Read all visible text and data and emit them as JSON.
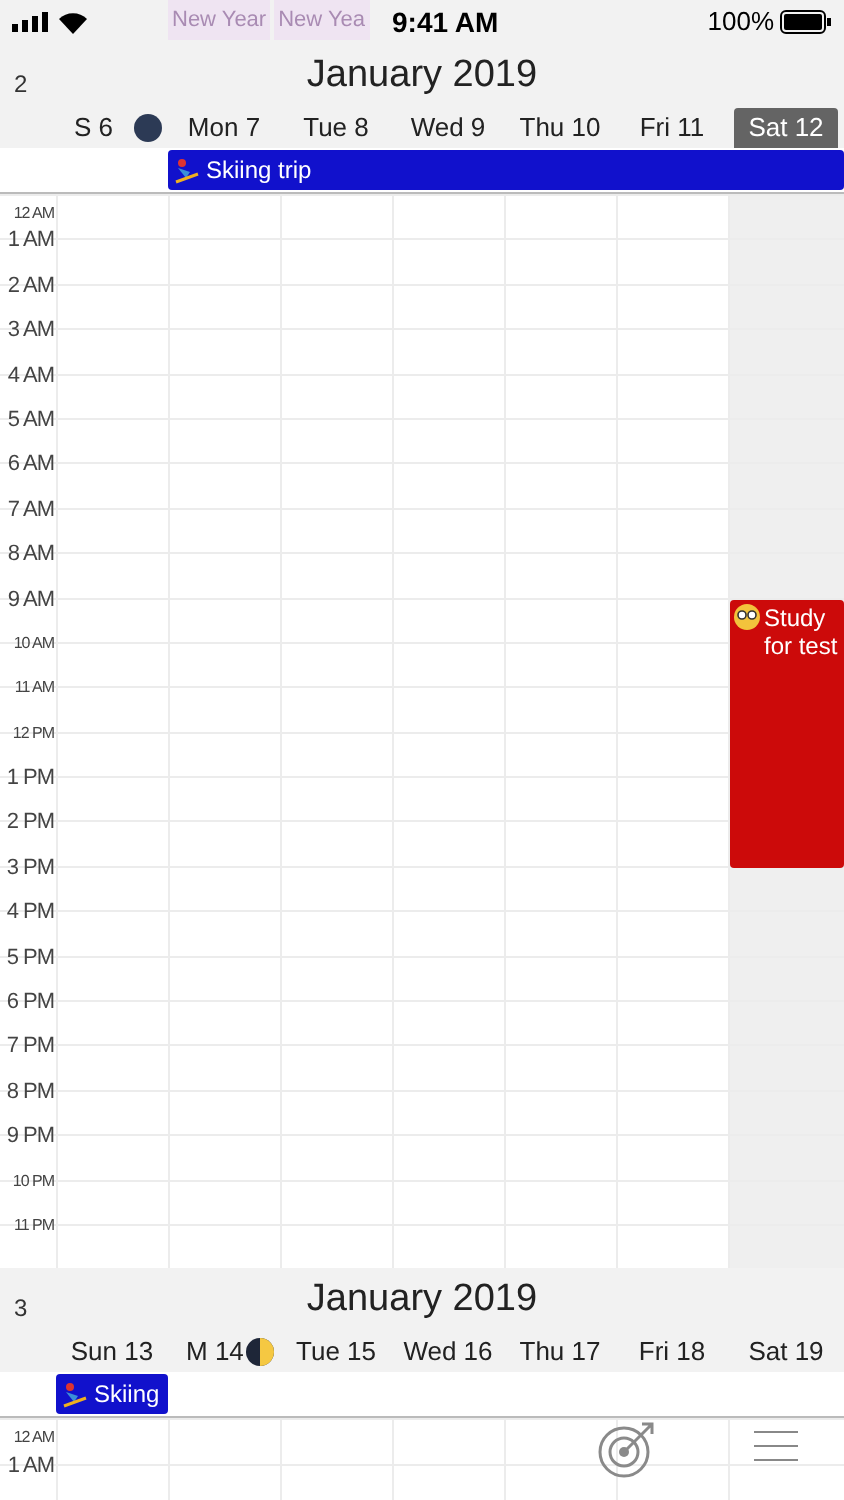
{
  "status_bar": {
    "time": "9:41 AM",
    "battery": "100%"
  },
  "background_events": [
    "New Year",
    "New Yea"
  ],
  "weeks": [
    {
      "week_number": "2",
      "title": "January 2019",
      "all_day_event": {
        "title": "Skiing trip",
        "color": "#1111cc"
      },
      "days": [
        {
          "label": "S 6",
          "selected": false,
          "moon": {
            "kind": "new"
          }
        },
        {
          "label": "Mon 7",
          "selected": false
        },
        {
          "label": "Tue 8",
          "selected": false
        },
        {
          "label": "Wed 9",
          "selected": false
        },
        {
          "label": "Thu 10",
          "selected": false
        },
        {
          "label": "Fri 11",
          "selected": false
        },
        {
          "label": "Sat 12",
          "selected": true,
          "events": [
            {
              "title": "Study for test",
              "color": "#cc0a0a"
            }
          ]
        }
      ],
      "hours": [
        {
          "label": "12 AM",
          "compact": true
        },
        {
          "label": "1 AM",
          "compact": false
        },
        {
          "label": "2 AM",
          "compact": false
        },
        {
          "label": "3 AM",
          "compact": false
        },
        {
          "label": "4 AM",
          "compact": false
        },
        {
          "label": "5 AM",
          "compact": false
        },
        {
          "label": "6 AM",
          "compact": false
        },
        {
          "label": "7 AM",
          "compact": false
        },
        {
          "label": "8 AM",
          "compact": false
        },
        {
          "label": "9 AM",
          "compact": false
        },
        {
          "label": "10 AM",
          "compact": true
        },
        {
          "label": "11 AM",
          "compact": true
        },
        {
          "label": "12 PM",
          "compact": true
        },
        {
          "label": "1 PM",
          "compact": false
        },
        {
          "label": "2 PM",
          "compact": false
        },
        {
          "label": "3 PM",
          "compact": false
        },
        {
          "label": "4 PM",
          "compact": false
        },
        {
          "label": "5 PM",
          "compact": false
        },
        {
          "label": "6 PM",
          "compact": false
        },
        {
          "label": "7 PM",
          "compact": false
        },
        {
          "label": "8 PM",
          "compact": false
        },
        {
          "label": "9 PM",
          "compact": false
        },
        {
          "label": "10 PM",
          "compact": true
        },
        {
          "label": "11 PM",
          "compact": true
        }
      ]
    },
    {
      "week_number": "3",
      "title": "January 2019",
      "all_day_event": {
        "title": "Skiing",
        "color": "#1111cc"
      },
      "days": [
        {
          "label": "Sun 13",
          "selected": false
        },
        {
          "label": "M 14",
          "selected": false,
          "moon": {
            "kind": "first_quarter"
          }
        },
        {
          "label": "Tue 15",
          "selected": false
        },
        {
          "label": "Wed 16",
          "selected": false
        },
        {
          "label": "Thu 17",
          "selected": false
        },
        {
          "label": "Fri 18",
          "selected": false
        },
        {
          "label": "Sat 19",
          "selected": false
        }
      ],
      "hours": [
        {
          "label": "12 AM",
          "compact": true
        },
        {
          "label": "1 AM",
          "compact": false
        }
      ]
    }
  ]
}
